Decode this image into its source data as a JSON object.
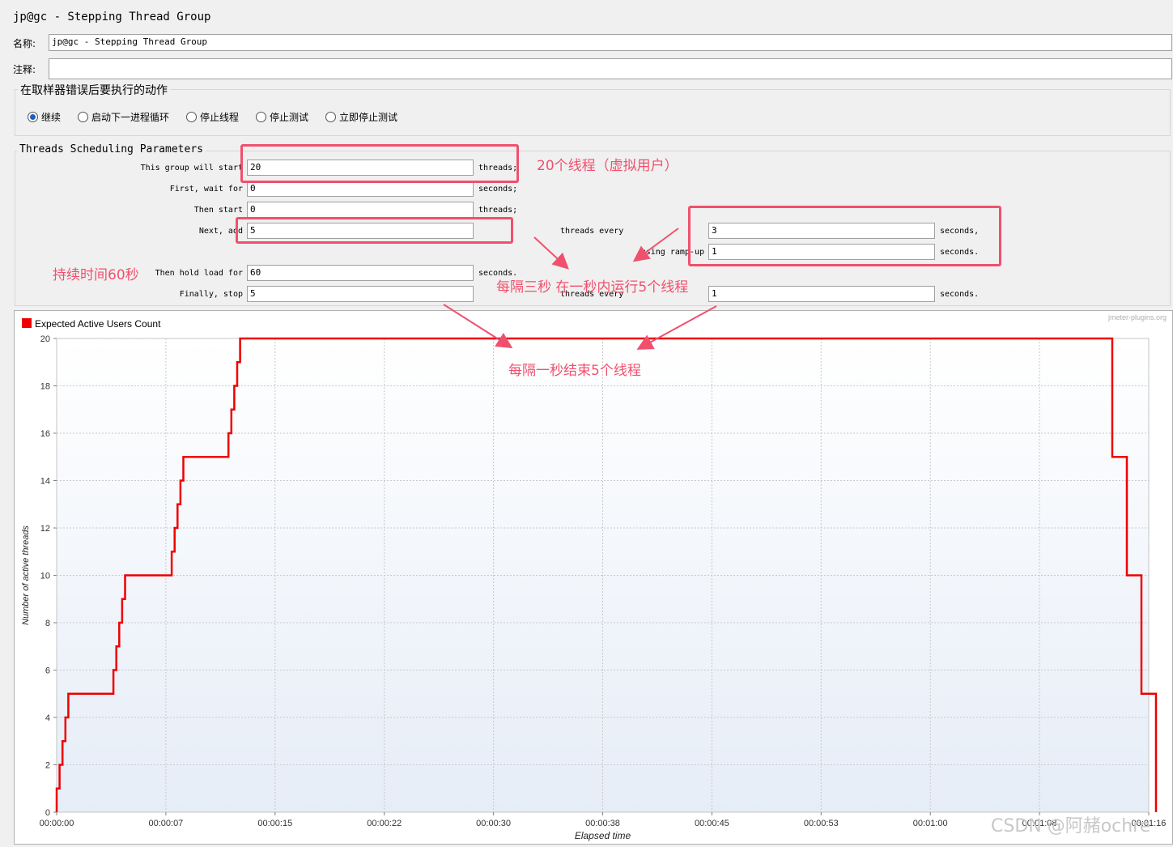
{
  "window": {
    "title": "jp@gc - Stepping Thread Group"
  },
  "form": {
    "name_label": "名称:",
    "name_value": "jp@gc - Stepping Thread Group",
    "comment_label": "注释:",
    "comment_value": ""
  },
  "sampler_error": {
    "title": "在取样器错误后要执行的动作",
    "options": [
      "继续",
      "启动下一进程循环",
      "停止线程",
      "停止测试",
      "立即停止测试"
    ],
    "selected": "继续"
  },
  "scheduling": {
    "title": "Threads Scheduling Parameters",
    "rows": [
      {
        "label": "This group will start",
        "value": "20",
        "unit": "threads;"
      },
      {
        "label": "First, wait for",
        "value": "0",
        "unit": "seconds;"
      },
      {
        "label": "Then start",
        "value": "0",
        "unit": "threads;"
      },
      {
        "label": "Next, add",
        "value": "5",
        "mid_label": "threads every",
        "value2": "3",
        "unit2": "seconds,"
      },
      {
        "label": "",
        "value": "",
        "mid_label": "using ramp-up",
        "value2": "1",
        "unit2": "seconds."
      },
      {
        "label": "Then hold load for",
        "value": "60",
        "unit": "seconds."
      },
      {
        "label": "Finally, stop",
        "value": "5",
        "mid_label": "threads every",
        "value2": "1",
        "unit2": "seconds."
      }
    ]
  },
  "annotations": {
    "threads": "20个线程（虚拟用户）",
    "hold": "持续时间60秒",
    "every3": "每隔三秒 在一秒内运行5个线程",
    "stop": "每隔一秒结束5个线程"
  },
  "chart": {
    "plugin_credit": "jmeter-plugins.org",
    "watermark": "CSDN @阿赭ochre"
  },
  "chart_data": {
    "type": "line",
    "legend": "Expected Active Users Count",
    "legend_position": "top-left",
    "xlabel": "Elapsed time",
    "ylabel": "Number of active threads",
    "x_tick_labels": [
      "00:00:00",
      "00:00:07",
      "00:00:15",
      "00:00:22",
      "00:00:30",
      "00:00:38",
      "00:00:45",
      "00:00:53",
      "00:01:00",
      "00:01:08",
      "00:01:16"
    ],
    "x_ticks_seconds": [
      0,
      7.5,
      15,
      22.5,
      30,
      37.5,
      45,
      52.5,
      60,
      67.5,
      75
    ],
    "y_ticks": [
      0,
      2,
      4,
      6,
      8,
      10,
      12,
      14,
      16,
      18,
      20
    ],
    "xlim_seconds": [
      0,
      75
    ],
    "ylim": [
      0,
      20
    ],
    "grid": true,
    "series": [
      {
        "name": "Expected Active Users Count",
        "color": "#ee0000",
        "points_seconds": [
          [
            0,
            0
          ],
          [
            0,
            1
          ],
          [
            0.2,
            1
          ],
          [
            0.2,
            2
          ],
          [
            0.4,
            2
          ],
          [
            0.4,
            3
          ],
          [
            0.6,
            3
          ],
          [
            0.6,
            4
          ],
          [
            0.8,
            4
          ],
          [
            0.8,
            5
          ],
          [
            3.9,
            5
          ],
          [
            3.9,
            6
          ],
          [
            4.1,
            6
          ],
          [
            4.1,
            7
          ],
          [
            4.3,
            7
          ],
          [
            4.3,
            8
          ],
          [
            4.5,
            8
          ],
          [
            4.5,
            9
          ],
          [
            4.7,
            9
          ],
          [
            4.7,
            10
          ],
          [
            7.9,
            10
          ],
          [
            7.9,
            11
          ],
          [
            8.1,
            11
          ],
          [
            8.1,
            12
          ],
          [
            8.3,
            12
          ],
          [
            8.3,
            13
          ],
          [
            8.5,
            13
          ],
          [
            8.5,
            14
          ],
          [
            8.7,
            14
          ],
          [
            8.7,
            15
          ],
          [
            11.8,
            15
          ],
          [
            11.8,
            16
          ],
          [
            12.0,
            16
          ],
          [
            12.0,
            17
          ],
          [
            12.2,
            17
          ],
          [
            12.2,
            18
          ],
          [
            12.4,
            18
          ],
          [
            12.4,
            19
          ],
          [
            12.6,
            19
          ],
          [
            12.6,
            20
          ],
          [
            72.5,
            20
          ],
          [
            72.5,
            15
          ],
          [
            73.5,
            15
          ],
          [
            73.5,
            10
          ],
          [
            74.5,
            10
          ],
          [
            74.5,
            5
          ],
          [
            75.5,
            5
          ],
          [
            75.5,
            0
          ]
        ]
      }
    ]
  }
}
